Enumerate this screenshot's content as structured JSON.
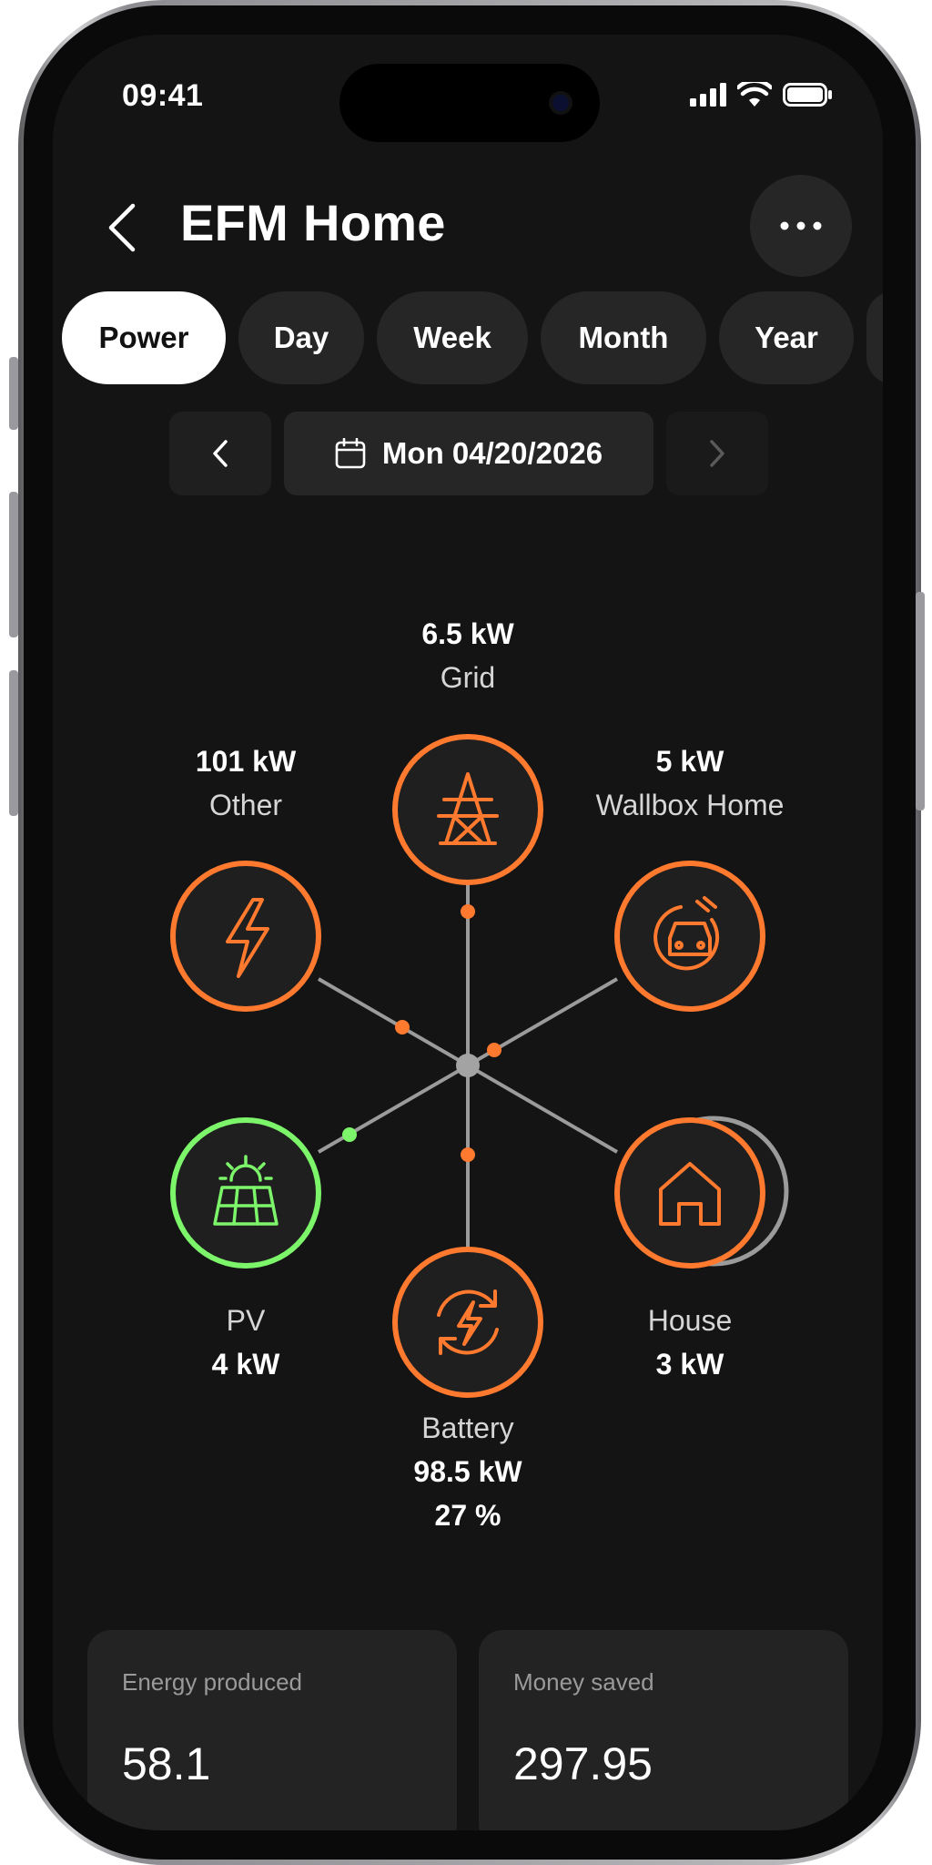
{
  "status_bar": {
    "time": "09:41"
  },
  "header": {
    "title": "EFM Home"
  },
  "tabs": [
    {
      "label": "Power",
      "active": true
    },
    {
      "label": "Day"
    },
    {
      "label": "Week"
    },
    {
      "label": "Month"
    },
    {
      "label": "Year"
    }
  ],
  "date_selector": {
    "date": "Mon 04/20/2026"
  },
  "nodes": {
    "grid": {
      "value": "6.5 kW",
      "name": "Grid"
    },
    "other": {
      "value": "101 kW",
      "name": "Other"
    },
    "wallbox": {
      "value": "5 kW",
      "name": "Wallbox Home"
    },
    "pv": {
      "value": "4 kW",
      "name": "PV"
    },
    "house": {
      "value": "3 kW",
      "name": "House"
    },
    "battery": {
      "value": "98.5 kW",
      "name": "Battery",
      "charge": "27 %"
    }
  },
  "stats": {
    "energy_produced": {
      "label": "Energy produced",
      "value": "58.1"
    },
    "money_saved": {
      "label": "Money saved",
      "value": "297.95"
    }
  },
  "colors": {
    "accent": "#FF7A2F",
    "pv_green": "#7CF56A",
    "background": "#141414",
    "line": "#9b9b9b"
  }
}
